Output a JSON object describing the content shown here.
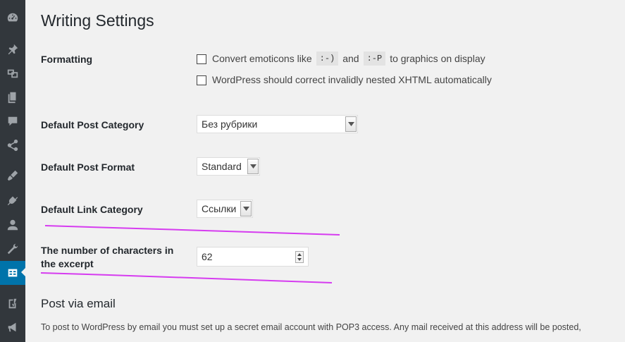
{
  "page": {
    "title": "Writing Settings"
  },
  "sidebar": {
    "items": [
      {
        "icon": "dashboard-icon"
      },
      {
        "icon": "pin-icon"
      },
      {
        "icon": "media-icon"
      },
      {
        "icon": "pages-icon"
      },
      {
        "icon": "comments-icon"
      },
      {
        "icon": "share-icon"
      },
      {
        "icon": "appearance-icon"
      },
      {
        "icon": "plugins-icon"
      },
      {
        "icon": "users-icon"
      },
      {
        "icon": "tools-icon"
      },
      {
        "icon": "settings-icon",
        "active": true
      },
      {
        "icon": "yoast-icon"
      },
      {
        "icon": "megaphone-icon"
      }
    ],
    "active_color": "#0073aa"
  },
  "formatting": {
    "label": "Formatting",
    "emoticons": {
      "checked": false,
      "text_before": "Convert emoticons like",
      "code1": ":-)",
      "text_mid": "and",
      "code2": ":-P",
      "text_after": "to graphics on display"
    },
    "xhtml": {
      "checked": false,
      "text": "WordPress should correct invalidly nested XHTML automatically"
    }
  },
  "default_post_category": {
    "label": "Default Post Category",
    "value": "Без рубрики"
  },
  "default_post_format": {
    "label": "Default Post Format",
    "value": "Standard"
  },
  "default_link_category": {
    "label": "Default Link Category",
    "value": "Ссылки"
  },
  "excerpt": {
    "label": "The number of characters in the excerpt",
    "value": "62"
  },
  "post_via_email": {
    "heading": "Post via email",
    "description": "To post to WordPress by email you must set up a secret email account with POP3 access. Any mail received at this address will be posted,"
  },
  "annotation_color": "#d63cf0"
}
